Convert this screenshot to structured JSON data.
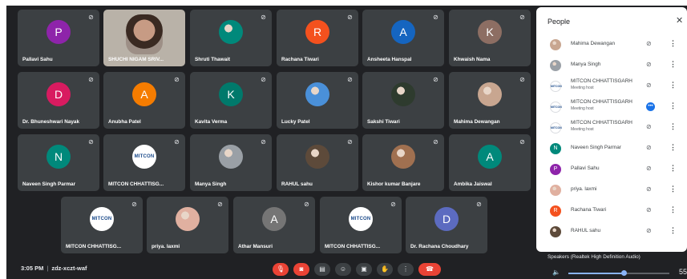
{
  "tiles": [
    {
      "name": "Pallavi Sahu",
      "initial": "P",
      "color": "#8e24aa",
      "kind": "letter"
    },
    {
      "name": "SHUCHI NIGAM SRIV...",
      "initial": "",
      "color": "",
      "kind": "video"
    },
    {
      "name": "Shruti Thawait",
      "initial": "",
      "color": "#00897b",
      "kind": "photo"
    },
    {
      "name": "Rachana Tiwari",
      "initial": "R",
      "color": "#f4511e",
      "kind": "letter"
    },
    {
      "name": "Ansheeta Hanspal",
      "initial": "A",
      "color": "#1565c0",
      "kind": "letter"
    },
    {
      "name": "Khwaish Nama",
      "initial": "K",
      "color": "#8d6e63",
      "kind": "letter"
    },
    {
      "name": "Dr. Bhuneshwari Nayak",
      "initial": "D",
      "color": "#d81b60",
      "kind": "letter"
    },
    {
      "name": "Anubha Patel",
      "initial": "A",
      "color": "#f57c00",
      "kind": "letter"
    },
    {
      "name": "Kavita Verma",
      "initial": "K",
      "color": "#00796b",
      "kind": "letter"
    },
    {
      "name": "Lucky Patel",
      "initial": "",
      "color": "#4a90d9",
      "kind": "photo"
    },
    {
      "name": "Sakshi Tiwari",
      "initial": "",
      "color": "#2e3b2e",
      "kind": "photo"
    },
    {
      "name": "Mahima Dewangan",
      "initial": "",
      "color": "#c8a690",
      "kind": "photo"
    },
    {
      "name": "Naveen Singh Parmar",
      "initial": "N",
      "color": "#00897b",
      "kind": "letter"
    },
    {
      "name": "MITCON CHHATTISG...",
      "initial": "MITCON",
      "color": "",
      "kind": "logo"
    },
    {
      "name": "Manya Singh",
      "initial": "",
      "color": "#9aa0a6",
      "kind": "photo"
    },
    {
      "name": "RAHUL sahu",
      "initial": "",
      "color": "#5d4a3a",
      "kind": "photo"
    },
    {
      "name": "Kishor kumar Banjare",
      "initial": "",
      "color": "#a07050",
      "kind": "photo"
    },
    {
      "name": "Ambika Jaiswal",
      "initial": "A",
      "color": "#00897b",
      "kind": "letter"
    },
    {
      "name": "MITCON CHHATTISG...",
      "initial": "MITCON",
      "color": "",
      "kind": "logo"
    },
    {
      "name": "priya. laxmi",
      "initial": "",
      "color": "#e0b0a0",
      "kind": "photo"
    },
    {
      "name": "Athar Mansuri",
      "initial": "A",
      "color": "#757575",
      "kind": "letter"
    },
    {
      "name": "MITCON CHHATTISG...",
      "initial": "MITCON",
      "color": "",
      "kind": "logo"
    },
    {
      "name": "Dr. Rachana Choudhary",
      "initial": "D",
      "color": "#5c6bc0",
      "kind": "letter"
    }
  ],
  "meeting": {
    "time": "3:05 PM",
    "separator": "|",
    "code": "zdz-xczt-waf"
  },
  "controls": [
    {
      "name": "mic-off-button",
      "glyph": "🎙",
      "style": "red"
    },
    {
      "name": "camera-off-button",
      "glyph": "◙",
      "style": "red"
    },
    {
      "name": "captions-button",
      "glyph": "▤",
      "style": ""
    },
    {
      "name": "emoji-button",
      "glyph": "☺",
      "style": ""
    },
    {
      "name": "present-button",
      "glyph": "▣",
      "style": ""
    },
    {
      "name": "raise-hand-button",
      "glyph": "✋",
      "style": ""
    },
    {
      "name": "more-options-button",
      "glyph": "⋮",
      "style": ""
    },
    {
      "name": "leave-call-button",
      "glyph": "☎",
      "style": "leave"
    }
  ],
  "people": {
    "title": "People",
    "close_glyph": "✕",
    "list": [
      {
        "name": "Mahima Dewangan",
        "sub": "",
        "initial": "",
        "color": "#c8a690",
        "kind": "photo",
        "speaking": false
      },
      {
        "name": "Manya Singh",
        "sub": "",
        "initial": "",
        "color": "#9aa0a6",
        "kind": "photo",
        "speaking": false
      },
      {
        "name": "MITCON CHHATTISGARH",
        "sub": "Meeting host",
        "initial": "MITCON",
        "color": "",
        "kind": "logo",
        "speaking": false
      },
      {
        "name": "MITCON CHHATTISGARH",
        "sub": "Meeting host",
        "initial": "MITCON",
        "color": "",
        "kind": "logo",
        "speaking": true
      },
      {
        "name": "MITCON CHHATTISGARH",
        "sub": "Meeting host",
        "initial": "MITCON",
        "color": "",
        "kind": "logo",
        "speaking": false
      },
      {
        "name": "Naveen Singh Parmar",
        "sub": "",
        "initial": "N",
        "color": "#00897b",
        "kind": "letter",
        "speaking": false
      },
      {
        "name": "Pallavi Sahu",
        "sub": "",
        "initial": "P",
        "color": "#8e24aa",
        "kind": "letter",
        "speaking": false
      },
      {
        "name": "priya. laxmi",
        "sub": "",
        "initial": "",
        "color": "#e0b0a0",
        "kind": "photo",
        "speaking": false
      },
      {
        "name": "Rachana Tiwari",
        "sub": "",
        "initial": "R",
        "color": "#f4511e",
        "kind": "letter",
        "speaking": false
      },
      {
        "name": "RAHUL sahu",
        "sub": "",
        "initial": "",
        "color": "#5d4a3a",
        "kind": "photo",
        "speaking": false
      }
    ]
  },
  "speakers": {
    "label": "Speakers (Realtek High Definition Audio)",
    "volume_fraction": 0.55,
    "value_text": "55"
  }
}
